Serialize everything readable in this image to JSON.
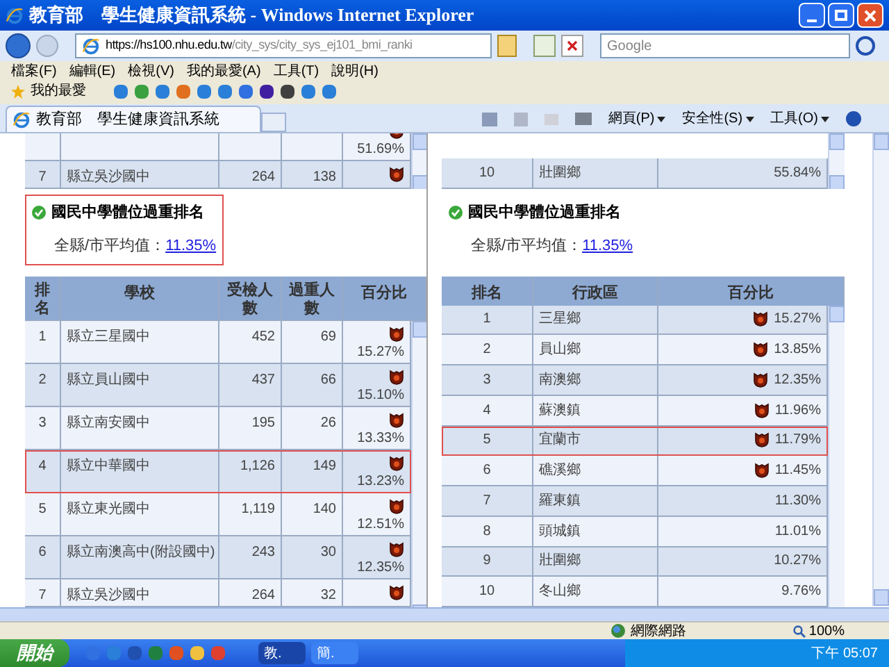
{
  "window": {
    "title": "教育部　學生健康資訊系統 - Windows Internet Explorer"
  },
  "address_bar": {
    "url_host": "https://hs100.nhu.edu.tw",
    "url_path": "/city_sys/city_sys_ej101_bmi_ranki",
    "search_placeholder": "Google"
  },
  "menu": [
    "檔案(F)",
    "編輯(E)",
    "檢視(V)",
    "我的最愛(A)",
    "工具(T)",
    "說明(H)"
  ],
  "favorites": {
    "label": "我的最愛"
  },
  "tab": {
    "title": "教育部　學生健康資訊系統"
  },
  "command_bar": [
    "網頁(P)",
    "安全性(S)",
    "工具(O)"
  ],
  "left_pane": {
    "top_rows": [
      {
        "rank": "",
        "school": "",
        "examined": "",
        "overweight": "",
        "percent": "51.69%",
        "flagged": true
      },
      {
        "rank": "7",
        "school": "縣立吳沙國中",
        "examined": "264",
        "overweight": "138",
        "percent": "",
        "flagged": true
      }
    ],
    "section": {
      "title": "國民中學體位過重排名",
      "average_label": "全縣/市平均值：",
      "average_value": "11.35%",
      "highlighted": true
    },
    "table": {
      "columns": [
        "排名",
        "學校",
        "受檢人數",
        "過重人數",
        "百分比"
      ],
      "rows": [
        {
          "rank": "1",
          "school": "縣立三星國中",
          "examined": "452",
          "overweight": "69",
          "percent": "15.27%",
          "flagged": true,
          "selected": false
        },
        {
          "rank": "2",
          "school": "縣立員山國中",
          "examined": "437",
          "overweight": "66",
          "percent": "15.10%",
          "flagged": true,
          "selected": false
        },
        {
          "rank": "3",
          "school": "縣立南安國中",
          "examined": "195",
          "overweight": "26",
          "percent": "13.33%",
          "flagged": true,
          "selected": false
        },
        {
          "rank": "4",
          "school": "縣立中華國中",
          "examined": "1,126",
          "overweight": "149",
          "percent": "13.23%",
          "flagged": true,
          "selected": true
        },
        {
          "rank": "5",
          "school": "縣立東光國中",
          "examined": "1,119",
          "overweight": "140",
          "percent": "12.51%",
          "flagged": true,
          "selected": false
        },
        {
          "rank": "6",
          "school": "縣立南澳高中(附設國中)",
          "examined": "243",
          "overweight": "30",
          "percent": "12.35%",
          "flagged": true,
          "selected": false
        },
        {
          "rank": "7",
          "school": "縣立吳沙國中",
          "examined": "264",
          "overweight": "32",
          "percent": "",
          "flagged": true,
          "selected": false
        }
      ]
    }
  },
  "right_pane": {
    "top_rows": [
      {
        "rank": "10",
        "district": "壯圍鄉",
        "percent": "55.84%",
        "flagged": false
      }
    ],
    "section": {
      "title": "國民中學體位過重排名",
      "average_label": "全縣/市平均值：",
      "average_value": "11.35%",
      "highlighted": false
    },
    "table": {
      "columns": [
        "排名",
        "行政區",
        "百分比"
      ],
      "rows": [
        {
          "rank": "1",
          "district": "三星鄉",
          "percent": "15.27%",
          "flagged": true,
          "selected": false
        },
        {
          "rank": "2",
          "district": "員山鄉",
          "percent": "13.85%",
          "flagged": true,
          "selected": false
        },
        {
          "rank": "3",
          "district": "南澳鄉",
          "percent": "12.35%",
          "flagged": true,
          "selected": false
        },
        {
          "rank": "4",
          "district": "蘇澳鎮",
          "percent": "11.96%",
          "flagged": true,
          "selected": false
        },
        {
          "rank": "5",
          "district": "宜蘭市",
          "percent": "11.79%",
          "flagged": true,
          "selected": true
        },
        {
          "rank": "6",
          "district": "礁溪鄉",
          "percent": "11.45%",
          "flagged": true,
          "selected": false
        },
        {
          "rank": "7",
          "district": "羅東鎮",
          "percent": "11.30%",
          "flagged": false,
          "selected": false
        },
        {
          "rank": "8",
          "district": "頭城鎮",
          "percent": "11.01%",
          "flagged": false,
          "selected": false
        },
        {
          "rank": "9",
          "district": "壯圍鄉",
          "percent": "10.27%",
          "flagged": false,
          "selected": false
        },
        {
          "rank": "10",
          "district": "冬山鄉",
          "percent": "9.76%",
          "flagged": false,
          "selected": false
        }
      ]
    }
  },
  "status_bar": {
    "zone": "網際網路",
    "zoom": "100%"
  },
  "taskbar": {
    "start": "開始",
    "tasks": [
      {
        "label": "教.",
        "selected": true
      },
      {
        "label": "簡.",
        "selected": false
      }
    ],
    "clock": "下午 05:07"
  }
}
